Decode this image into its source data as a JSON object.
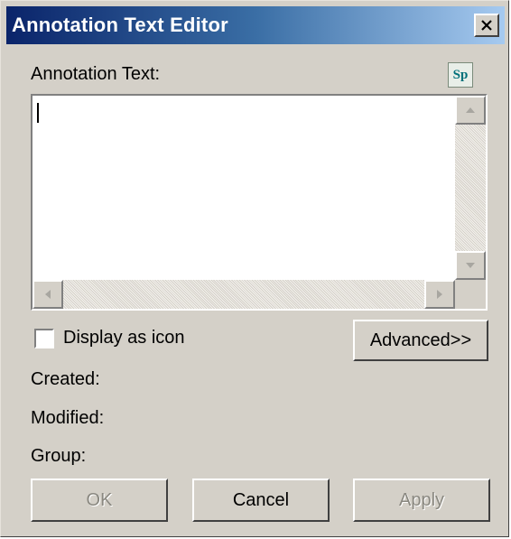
{
  "window": {
    "title": "Annotation Text Editor",
    "close_label": "×"
  },
  "annotation": {
    "label": "Annotation Text:",
    "value": "",
    "spell_check_label": "Sp"
  },
  "options": {
    "display_as_icon_label": "Display as icon",
    "display_as_icon_checked": false,
    "advanced_label": "Advanced>>"
  },
  "info": {
    "created_label": "Created:",
    "modified_label": "Modified:",
    "group_label": "Group:"
  },
  "buttons": {
    "ok_label": "OK",
    "cancel_label": "Cancel",
    "apply_label": "Apply"
  },
  "icons": {
    "close": "close-icon",
    "spell_check": "spell-check-icon",
    "scroll_up": "arrow-up-icon",
    "scroll_down": "arrow-down-icon",
    "scroll_left": "arrow-left-icon",
    "scroll_right": "arrow-right-icon"
  },
  "colors": {
    "title_start": "#0a246a",
    "title_end": "#a6caf0",
    "face": "#d4d0c8",
    "spell_icon": "#00707a"
  }
}
